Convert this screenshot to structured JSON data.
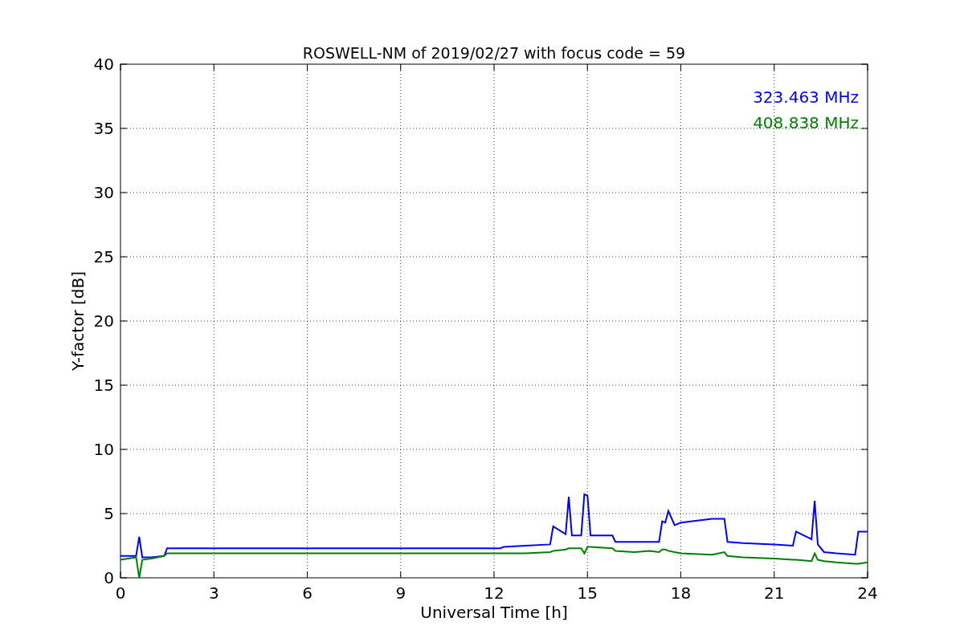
{
  "figure": {
    "chart_data": {
      "type": "line",
      "title": "ROSWELL-NM of 2019/02/27 with focus code = 59",
      "xlabel": "Universal Time [h]",
      "ylabel": "Y-factor [dB]",
      "x": [
        0,
        0.5,
        0.6,
        0.7,
        1.0,
        1.4,
        1.5,
        3,
        6,
        9,
        12.2,
        12.3,
        13,
        13.8,
        13.9,
        14.3,
        14.4,
        14.5,
        14.8,
        14.9,
        15.0,
        15.1,
        15.8,
        15.9,
        16.5,
        17.0,
        17.3,
        17.4,
        17.5,
        17.6,
        17.8,
        18,
        19,
        19.4,
        19.5,
        20,
        21,
        21.6,
        21.7,
        22.2,
        22.3,
        22.4,
        22.6,
        23,
        23.6,
        23.7,
        24
      ],
      "series": [
        {
          "name": "323.463 MHz",
          "color": "#0000ff",
          "values": [
            1.7,
            1.7,
            3.2,
            1.6,
            1.6,
            1.7,
            2.3,
            2.3,
            2.3,
            2.3,
            2.3,
            2.4,
            2.5,
            2.6,
            4.0,
            3.4,
            6.3,
            3.3,
            3.3,
            6.5,
            6.4,
            3.3,
            3.3,
            2.8,
            2.8,
            2.8,
            2.8,
            4.4,
            4.3,
            5.2,
            4.1,
            4.3,
            4.6,
            4.6,
            2.8,
            2.7,
            2.6,
            2.5,
            3.6,
            3.0,
            6.0,
            2.6,
            2.0,
            1.9,
            1.8,
            3.6,
            3.6
          ]
        },
        {
          "name": "408.838 MHz",
          "color": "#008000",
          "values": [
            1.4,
            1.6,
            0,
            1.4,
            1.5,
            1.7,
            1.9,
            1.9,
            1.9,
            1.9,
            1.9,
            1.9,
            1.9,
            2.0,
            2.1,
            2.2,
            2.3,
            2.3,
            2.3,
            1.9,
            2.4,
            2.4,
            2.3,
            2.1,
            2.0,
            2.1,
            2.0,
            2.2,
            2.2,
            2.1,
            2.0,
            1.9,
            1.8,
            2.0,
            1.7,
            1.6,
            1.5,
            1.4,
            1.4,
            1.3,
            1.9,
            1.4,
            1.3,
            1.2,
            1.1,
            1.1,
            1.2
          ]
        }
      ],
      "grid": true,
      "xlim": [
        0,
        24
      ],
      "ylim": [
        0,
        40
      ],
      "xticks": [
        0,
        3,
        6,
        9,
        12,
        15,
        18,
        21,
        24
      ],
      "yticks": [
        0,
        5,
        10,
        15,
        20,
        25,
        30,
        35,
        40
      ]
    }
  }
}
